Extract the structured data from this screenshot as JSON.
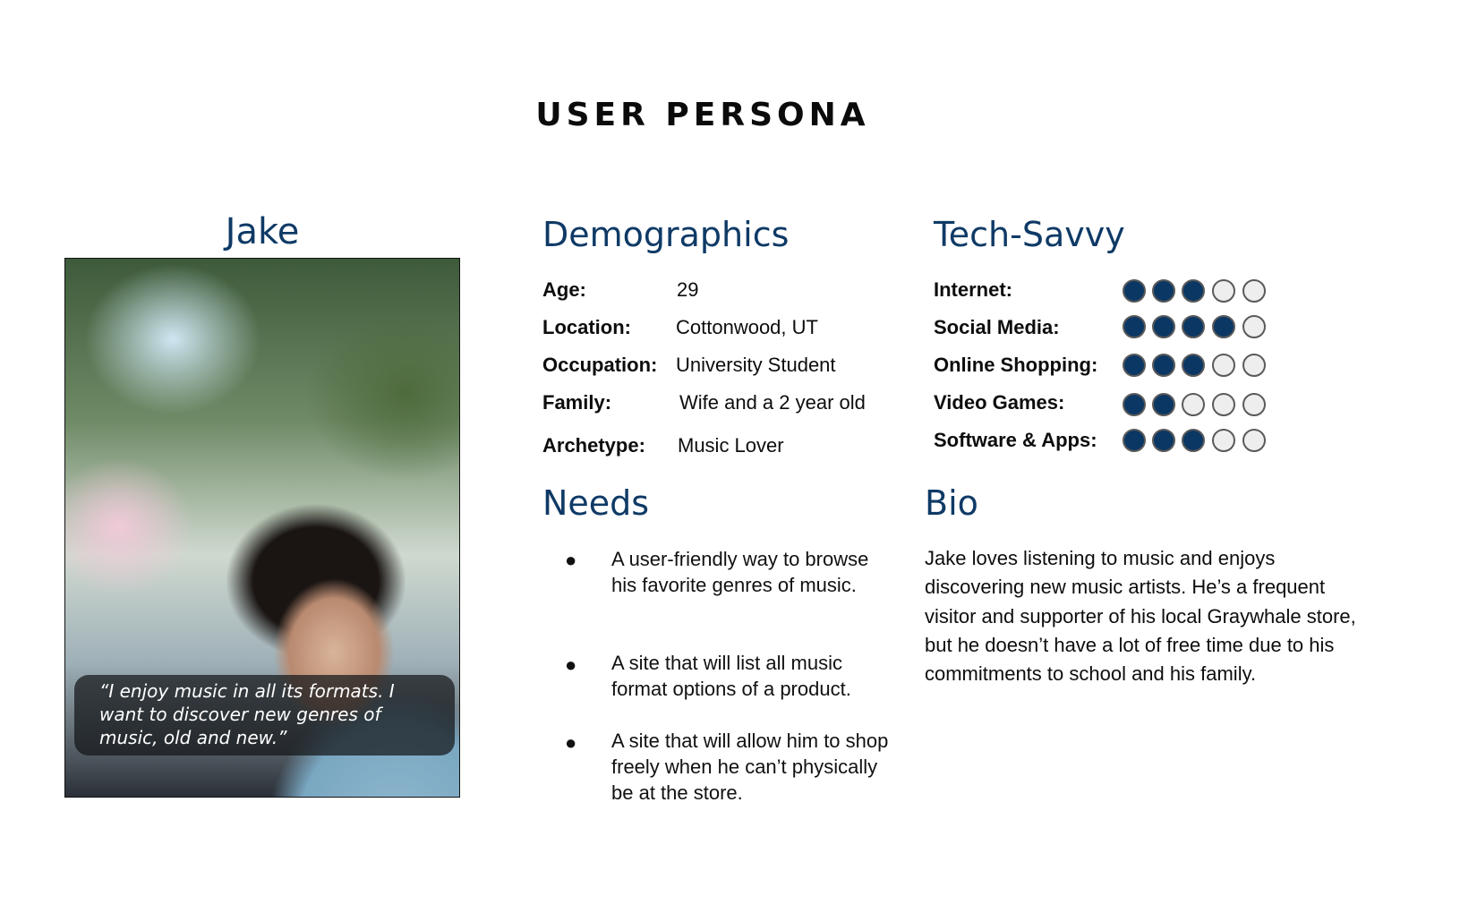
{
  "title": "USER PERSONA",
  "persona": {
    "name": "Jake",
    "photo_icon": "persona-photo",
    "quote": "“I enjoy music in all its formats. I want to discover new genres of music, old and new.”"
  },
  "demographics": {
    "heading": "Demographics",
    "rows": [
      {
        "label": "Age:",
        "value": "29"
      },
      {
        "label": "Location:",
        "value": "Cottonwood, UT"
      },
      {
        "label": "Occupation:",
        "value": "University Student"
      },
      {
        "label": "Family:",
        "value": "Wife and a 2 year old"
      },
      {
        "label": "Archetype:",
        "value": "Music Lover"
      }
    ]
  },
  "tech_savvy": {
    "heading": "Tech-Savvy",
    "scale_max": 5,
    "colors": {
      "filled": "#0b3764",
      "empty": "#eeeeee"
    },
    "rows": [
      {
        "label": "Internet:",
        "rating": 3
      },
      {
        "label": "Social Media:",
        "rating": 4
      },
      {
        "label": "Online Shopping:",
        "rating": 3
      },
      {
        "label": "Video Games:",
        "rating": 2
      },
      {
        "label": "Software & Apps:",
        "rating": 3
      }
    ]
  },
  "needs": {
    "heading": "Needs",
    "bullet": "●",
    "items": [
      "A user-friendly way to browse his favorite genres of music.",
      "A site that will list all music format options of a product.",
      "A site that will allow him to shop freely when he can’t physically be at the store."
    ]
  },
  "bio": {
    "heading": "Bio",
    "text": "Jake loves listening to music and enjoys discovering new music artists. He’s a frequent visitor and supporter of his local Graywhale store, but he doesn’t have a lot of free time due to his commitments to school and his family."
  }
}
